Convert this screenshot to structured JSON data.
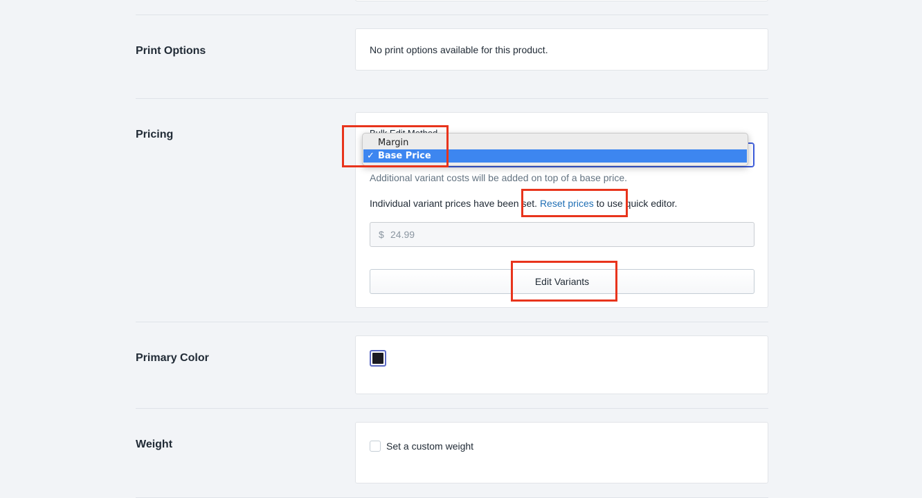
{
  "print_options": {
    "label": "Print Options",
    "message": "No print options available for this product."
  },
  "pricing": {
    "label": "Pricing",
    "bulk_edit_label": "Bulk Edit Method",
    "dropdown_options": [
      {
        "label": "Margin",
        "selected": false
      },
      {
        "label": "Base Price",
        "selected": true
      }
    ],
    "selected_check": "✓",
    "help_text": "Additional variant costs will be added on top of a base price.",
    "variant_note_prefix": "Individual variant prices have been set.",
    "reset_link": "Reset prices",
    "variant_note_suffix": "to use quick editor.",
    "currency_symbol": "$",
    "price_value": "24.99",
    "edit_variants_button": "Edit Variants"
  },
  "primary_color": {
    "label": "Primary Color",
    "swatch_color": "#1b1b22"
  },
  "weight": {
    "label": "Weight",
    "checkbox_label": "Set a custom weight",
    "checked": false
  },
  "colors": {
    "accent": "#3b5bdb",
    "link": "#1f6fb5",
    "selection": "#3d86f0",
    "annotation": "#e8341c"
  }
}
